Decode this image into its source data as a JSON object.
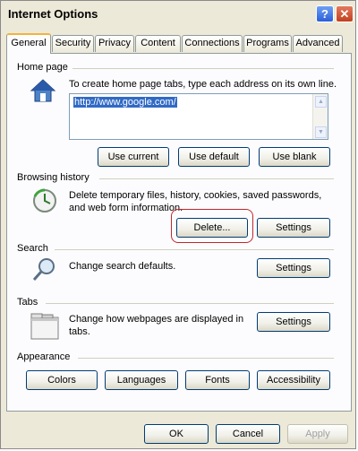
{
  "window": {
    "title": "Internet Options",
    "help_glyph": "?",
    "close_glyph": "✕"
  },
  "tabs": [
    {
      "label": "General"
    },
    {
      "label": "Security"
    },
    {
      "label": "Privacy"
    },
    {
      "label": "Content"
    },
    {
      "label": "Connections"
    },
    {
      "label": "Programs"
    },
    {
      "label": "Advanced"
    }
  ],
  "home_page": {
    "label": "Home page",
    "description": "To create home page tabs, type each address on its own line.",
    "url": "http://www.google.com/",
    "use_current": "Use current",
    "use_default": "Use default",
    "use_blank": "Use blank"
  },
  "browsing_history": {
    "label": "Browsing history",
    "description_line1": "Delete temporary files, history, cookies, saved passwords,",
    "description_line2": "and web form information.",
    "delete": "Delete...",
    "settings": "Settings"
  },
  "search": {
    "label": "Search",
    "description": "Change search defaults.",
    "settings": "Settings"
  },
  "tabs_section": {
    "label": "Tabs",
    "description_line1": "Change how webpages are displayed in",
    "description_line2": "tabs.",
    "settings": "Settings"
  },
  "appearance": {
    "label": "Appearance",
    "colors": "Colors",
    "languages": "Languages",
    "fonts": "Fonts",
    "accessibility": "Accessibility"
  },
  "footer": {
    "ok": "OK",
    "cancel": "Cancel",
    "apply": "Apply"
  },
  "colors": {
    "highlight": "#c0282c",
    "accent_tab": "#f0b33c",
    "selection": "#316ac5"
  }
}
